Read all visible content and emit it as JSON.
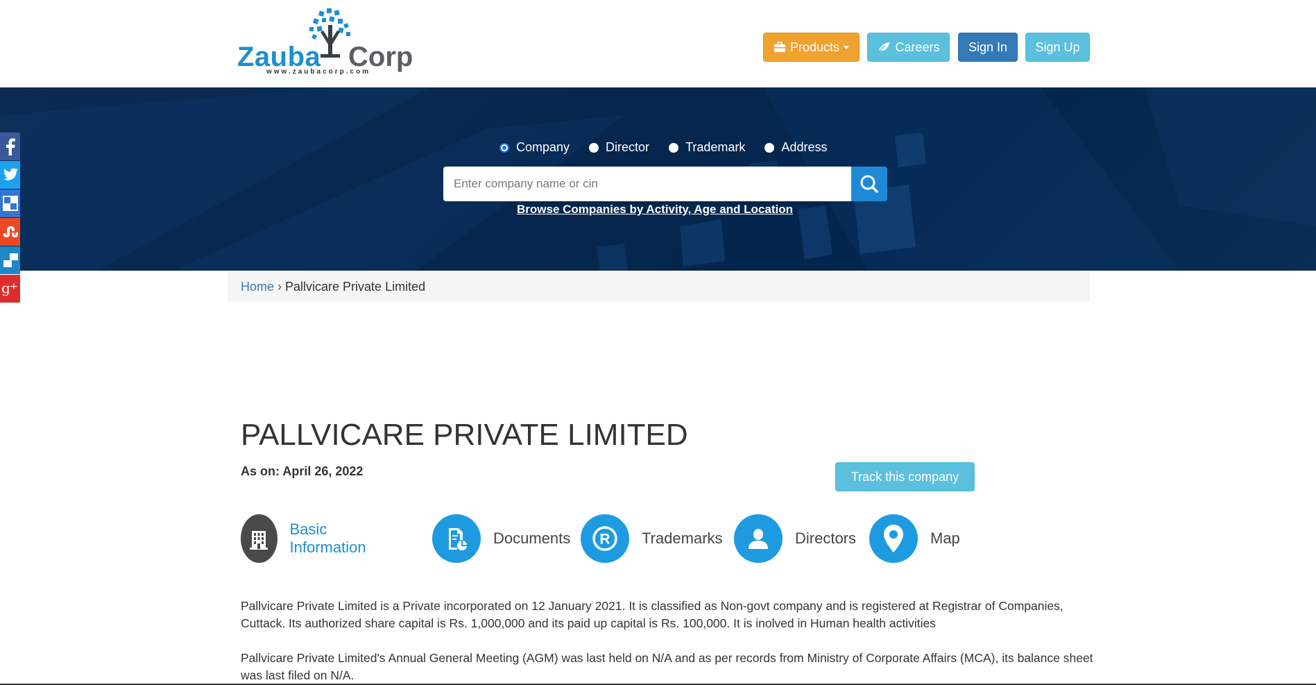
{
  "header": {
    "logo": {
      "brand_left": "Zauba",
      "brand_right": "Corp",
      "url": "www.zaubacorp.com"
    },
    "nav": {
      "products": "Products",
      "careers": "Careers",
      "sign_in": "Sign In",
      "sign_up": "Sign Up"
    }
  },
  "search": {
    "options": [
      {
        "label": "Company",
        "checked": true
      },
      {
        "label": "Director",
        "checked": false
      },
      {
        "label": "Trademark",
        "checked": false
      },
      {
        "label": "Address",
        "checked": false
      }
    ],
    "placeholder": "Enter company name or cin",
    "browse_link": "Browse Companies by Activity, Age and Location"
  },
  "social": [
    "facebook-icon",
    "twitter-icon",
    "delicious-icon",
    "stumbleupon-icon",
    "digg-icon",
    "google-plus-icon"
  ],
  "breadcrumb": {
    "home": "Home",
    "separator": "›",
    "current": "Pallvicare Private Limited"
  },
  "company": {
    "name": "PALLVICARE PRIVATE LIMITED",
    "as_on": "As on: April 26, 2022",
    "track_button": "Track this company",
    "tabs": [
      {
        "label": "Basic Information",
        "icon": "building-icon",
        "active": true
      },
      {
        "label": "Documents",
        "icon": "document-icon",
        "active": false
      },
      {
        "label": "Trademarks",
        "icon": "registered-icon",
        "active": false
      },
      {
        "label": "Directors",
        "icon": "person-icon",
        "active": false
      },
      {
        "label": "Map",
        "icon": "map-pin-icon",
        "active": false
      }
    ],
    "description": [
      "Pallvicare Private Limited is a Private incorporated on 12 January 2021. It is classified as Non-govt company and is registered at Registrar of Companies, Cuttack. Its authorized share capital is Rs. 1,000,000 and its paid up capital is Rs. 100,000. It is inolved in Human health activities",
      "Pallvicare Private Limited's Annual General Meeting (AGM) was last held on N/A and as per records from Ministry of Corporate Affairs (MCA), its balance sheet was last filed on N/A."
    ]
  },
  "colors": {
    "brand_blue": "#1d8fce",
    "products_orange": "#f0a22f",
    "info_cyan": "#5bc0de",
    "primary_blue": "#337ab7",
    "hero_navy": "#06264d"
  }
}
